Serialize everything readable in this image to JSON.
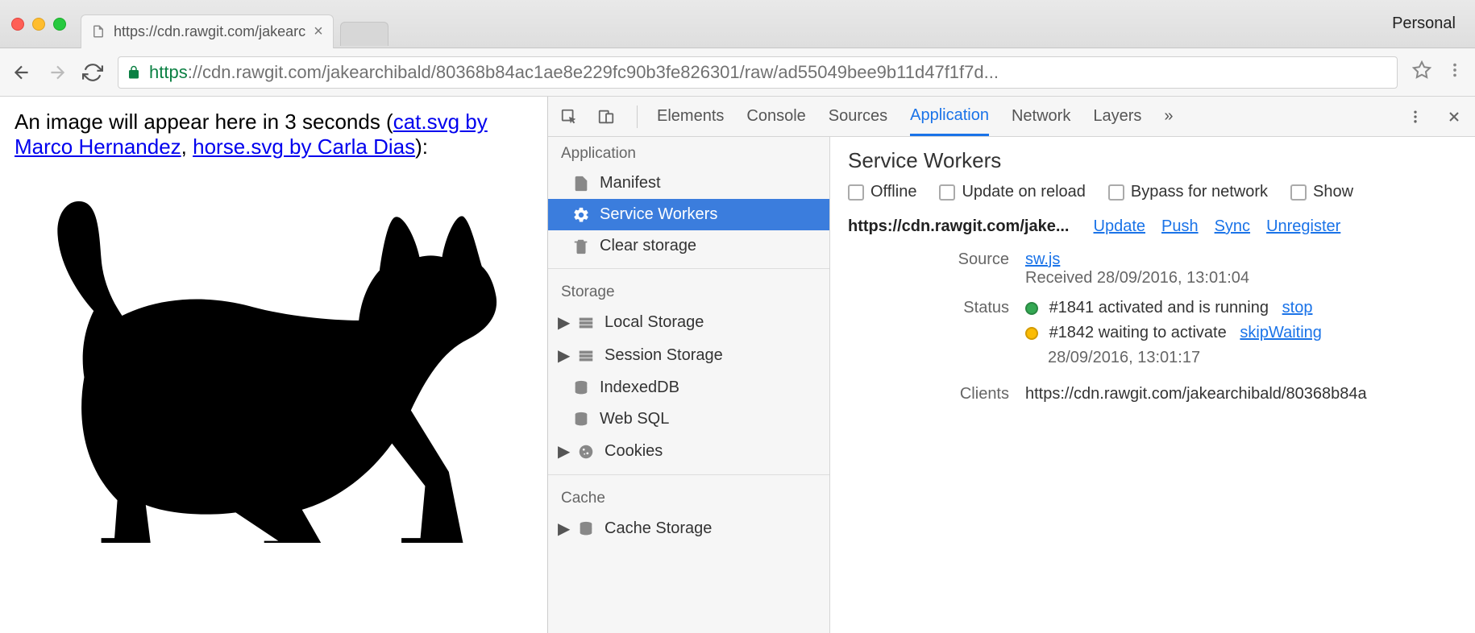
{
  "chrome": {
    "tab_title": "https://cdn.rawgit.com/jakearc",
    "profile": "Personal",
    "url_scheme": "https",
    "url_host_path": "://cdn.rawgit.com/jakearchibald/80368b84ac1ae8e229fc90b3fe826301/raw/ad55049bee9b11d47f1f7d..."
  },
  "page": {
    "text_prefix": "An image will appear here in 3 seconds (",
    "link1": "cat.svg by Marco Hernandez",
    "sep": ", ",
    "link2": "horse.svg by Carla Dias",
    "text_suffix": "):"
  },
  "devtools": {
    "tabs": [
      "Elements",
      "Console",
      "Sources",
      "Application",
      "Network",
      "Layers"
    ],
    "active_tab": "Application",
    "overflow": "»"
  },
  "sidebar": {
    "application": {
      "title": "Application",
      "items": [
        "Manifest",
        "Service Workers",
        "Clear storage"
      ],
      "selected": "Service Workers"
    },
    "storage": {
      "title": "Storage",
      "items": [
        "Local Storage",
        "Session Storage",
        "IndexedDB",
        "Web SQL",
        "Cookies"
      ]
    },
    "cache": {
      "title": "Cache",
      "items": [
        "Cache Storage"
      ]
    }
  },
  "sw": {
    "title": "Service Workers",
    "checks": [
      "Offline",
      "Update on reload",
      "Bypass for network",
      "Show"
    ],
    "origin": "https://cdn.rawgit.com/jake...",
    "actions": [
      "Update",
      "Push",
      "Sync",
      "Unregister"
    ],
    "rows": {
      "source_label": "Source",
      "source_file": "sw.js",
      "source_received": "Received 28/09/2016, 13:01:04",
      "status_label": "Status",
      "status1_text": "#1841 activated and is running",
      "status1_action": "stop",
      "status2_text": "#1842 waiting to activate",
      "status2_action": "skipWaiting",
      "status2_time": "28/09/2016, 13:01:17",
      "clients_label": "Clients",
      "clients_val": "https://cdn.rawgit.com/jakearchibald/80368b84a"
    }
  }
}
